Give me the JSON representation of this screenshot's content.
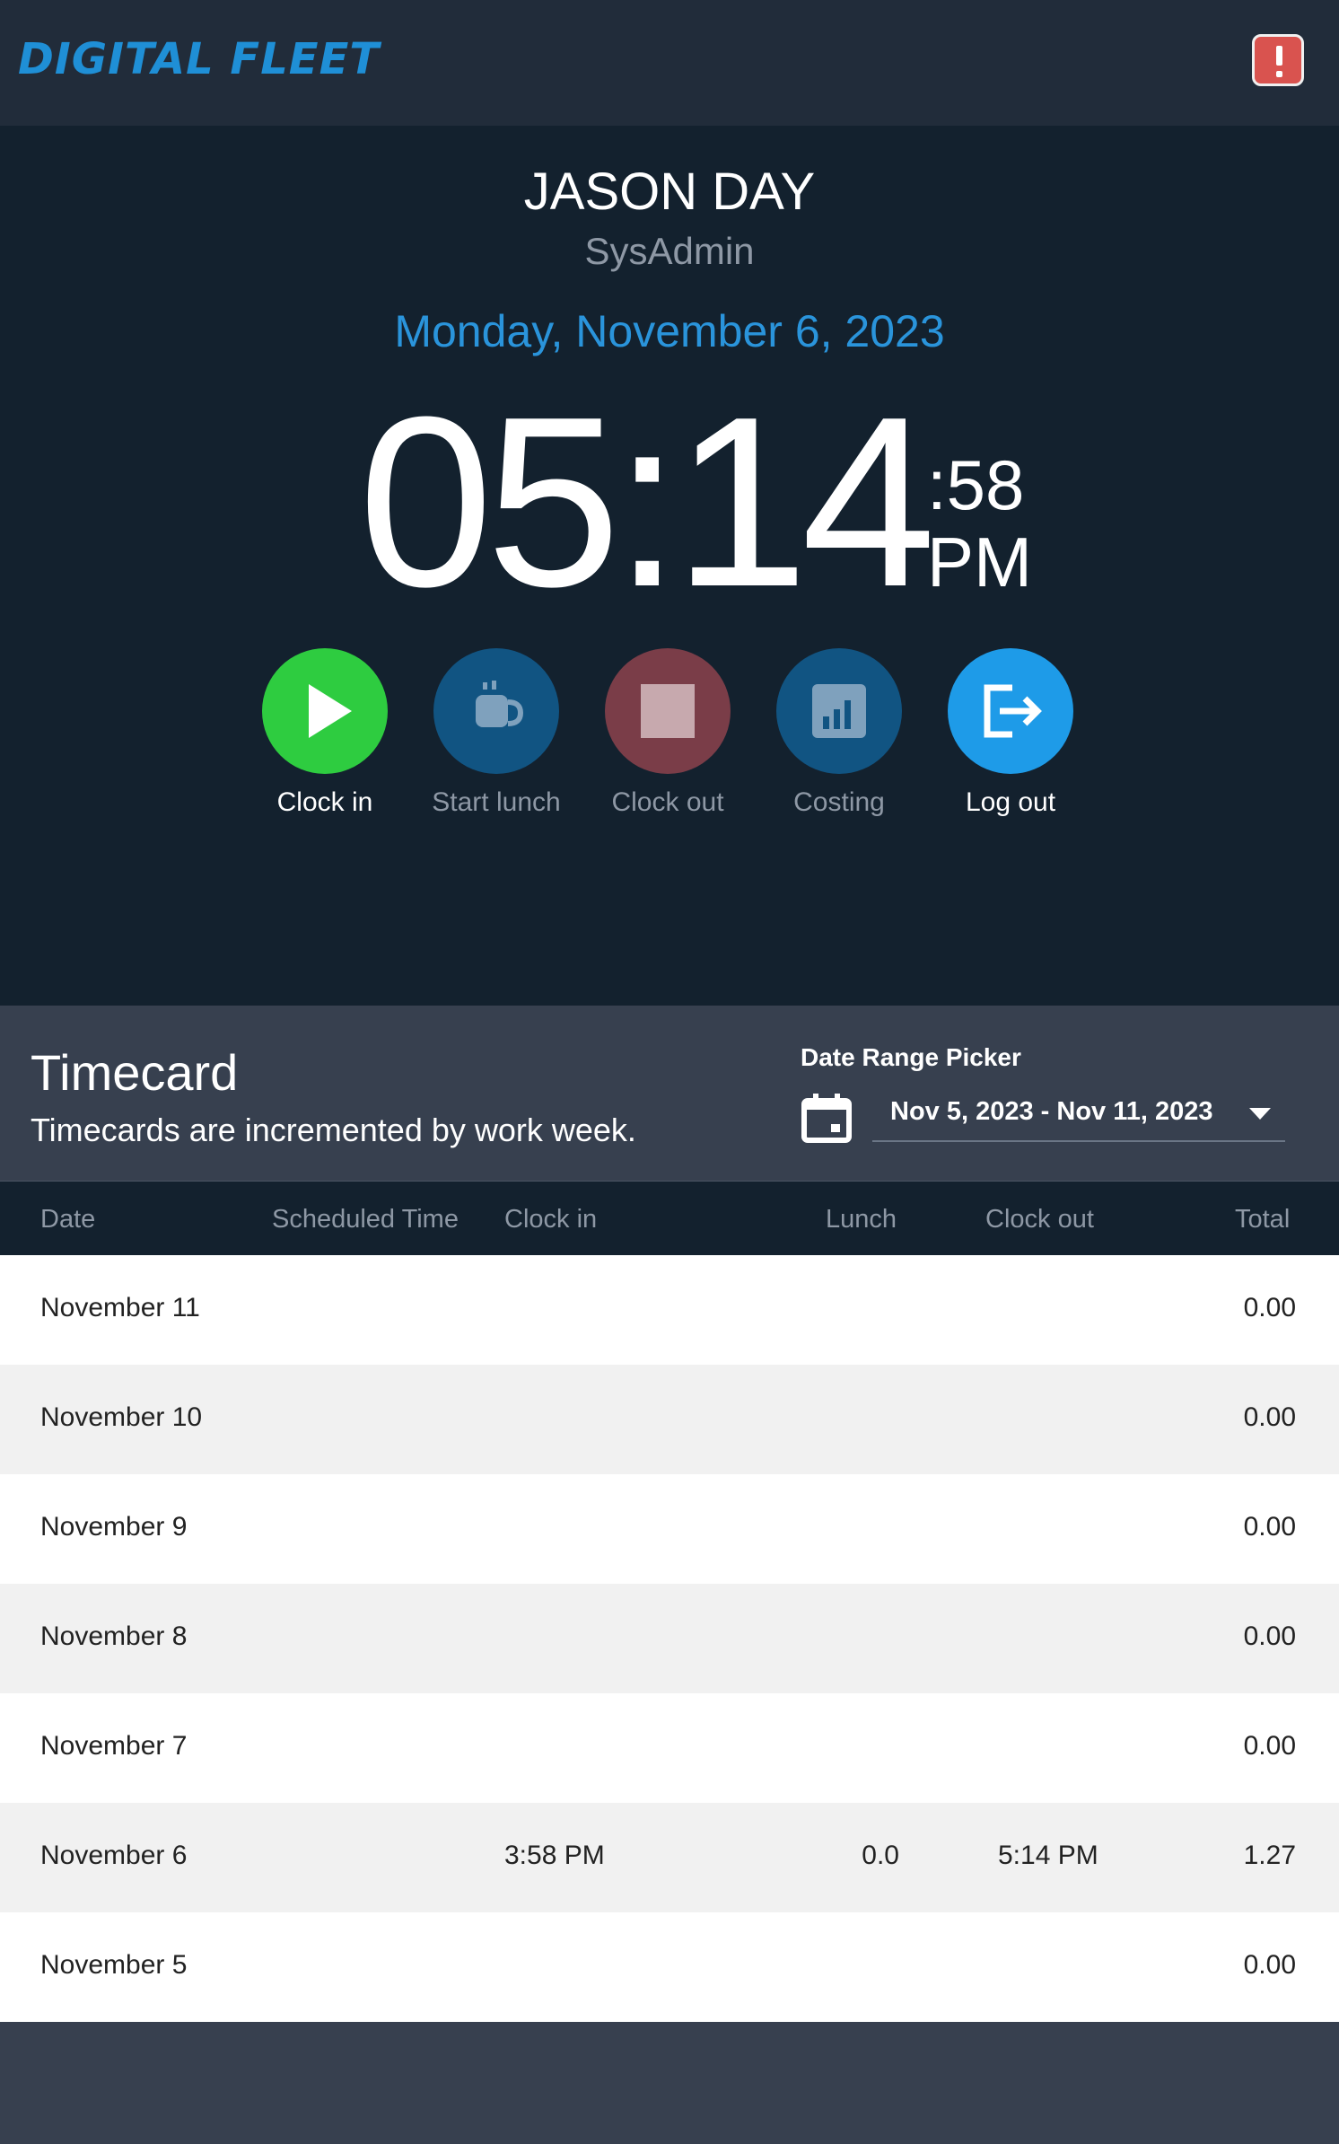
{
  "header": {
    "logo_text": "DIGITAL FLEET"
  },
  "user": {
    "name": "JASON DAY",
    "role": "SysAdmin"
  },
  "date": "Monday, November 6, 2023",
  "clock": {
    "hours_minutes": "05:14",
    "seconds": ":58",
    "ampm": "PM"
  },
  "actions": [
    {
      "label": "Clock in",
      "icon": "play-icon",
      "enabled": true,
      "color": "#2ecc40"
    },
    {
      "label": "Start lunch",
      "icon": "coffee-cup-icon",
      "enabled": false,
      "color": "#115482"
    },
    {
      "label": "Clock out",
      "icon": "stop-icon",
      "enabled": false,
      "color": "#7a3d48"
    },
    {
      "label": "Costing",
      "icon": "bar-chart-icon",
      "enabled": false,
      "color": "#115482"
    },
    {
      "label": "Log out",
      "icon": "logout-icon",
      "enabled": true,
      "color": "#1e9be8"
    }
  ],
  "timecard": {
    "title": "Timecard",
    "subtitle": "Timecards are incremented by work week.",
    "date_range_label": "Date Range Picker",
    "date_range_value": "Nov 5, 2023 - Nov 11, 2023"
  },
  "table": {
    "columns": [
      "Date",
      "Scheduled Time",
      "Clock in",
      "Lunch",
      "Clock out",
      "Total"
    ],
    "rows": [
      {
        "date": "November 11",
        "scheduled": "",
        "clock_in": "",
        "lunch": "",
        "clock_out": "",
        "total": "0.00"
      },
      {
        "date": "November 10",
        "scheduled": "",
        "clock_in": "",
        "lunch": "",
        "clock_out": "",
        "total": "0.00"
      },
      {
        "date": "November 9",
        "scheduled": "",
        "clock_in": "",
        "lunch": "",
        "clock_out": "",
        "total": "0.00"
      },
      {
        "date": "November 8",
        "scheduled": "",
        "clock_in": "",
        "lunch": "",
        "clock_out": "",
        "total": "0.00"
      },
      {
        "date": "November 7",
        "scheduled": "",
        "clock_in": "",
        "lunch": "",
        "clock_out": "",
        "total": "0.00"
      },
      {
        "date": "November 6",
        "scheduled": "",
        "clock_in": "3:58 PM",
        "lunch": "0.0",
        "clock_out": "5:14 PM",
        "total": "1.27"
      },
      {
        "date": "November 5",
        "scheduled": "",
        "clock_in": "",
        "lunch": "",
        "clock_out": "",
        "total": "0.00"
      }
    ]
  },
  "colors": {
    "accent": "#2a94db",
    "alert": "#d9534f",
    "panel": "#13212e",
    "header": "#212c3a"
  }
}
